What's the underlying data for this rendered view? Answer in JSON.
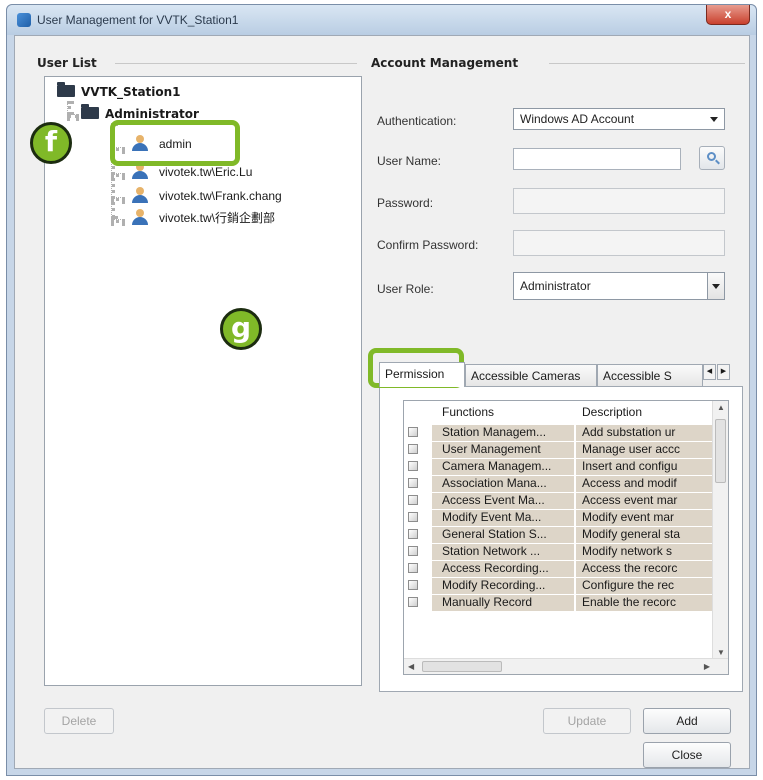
{
  "window": {
    "title": "User Management for VVTK_Station1",
    "close_glyph": "x"
  },
  "user_list": {
    "group_label": "User List",
    "root": "VVTK_Station1",
    "group": "Administrator",
    "users": [
      "admin",
      "vivotek.tw\\Eric.Lu",
      "vivotek.tw\\Frank.chang",
      "vivotek.tw\\行銷企劃部"
    ]
  },
  "account": {
    "group_label": "Account Management",
    "authentication_label": "Authentication:",
    "authentication_value": "Windows AD Account",
    "username_label": "User Name:",
    "username_value": "",
    "password_label": "Password:",
    "confirm_label": "Confirm Password:",
    "role_label": "User Role:",
    "role_value": "Administrator"
  },
  "tabs": [
    "Permission",
    "Accessible Cameras",
    "Accessible S"
  ],
  "permissions": {
    "headers": [
      "Functions",
      "Description"
    ],
    "rows": [
      {
        "fn": "Station Managem...",
        "desc": "Add substation ur"
      },
      {
        "fn": "User Management",
        "desc": "Manage user accc"
      },
      {
        "fn": "Camera Managem...",
        "desc": "Insert and configu"
      },
      {
        "fn": "Association Mana...",
        "desc": "Access and modif"
      },
      {
        "fn": "Access Event Ma...",
        "desc": "Access event mar"
      },
      {
        "fn": "Modify Event Ma...",
        "desc": "Modify event mar"
      },
      {
        "fn": "General Station S...",
        "desc": "Modify general sta"
      },
      {
        "fn": "Station Network ...",
        "desc": "Modify network s"
      },
      {
        "fn": "Access Recording...",
        "desc": "Access the recorc"
      },
      {
        "fn": "Modify Recording...",
        "desc": "Configure the rec"
      },
      {
        "fn": "Manually Record",
        "desc": "Enable the recorc"
      }
    ]
  },
  "buttons": {
    "delete": "Delete",
    "update": "Update",
    "add": "Add",
    "close": "Close"
  },
  "callouts": {
    "f": "f",
    "g": "g"
  },
  "colors": {
    "highlight": "#80b928",
    "row_bg": "#ddd5c8"
  }
}
